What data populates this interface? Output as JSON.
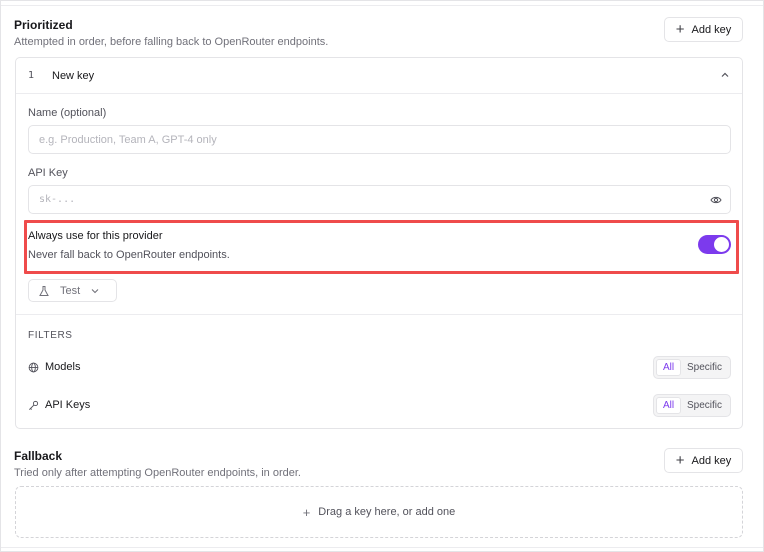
{
  "prioritized": {
    "title": "Prioritized",
    "subtitle": "Attempted in order, before falling back to OpenRouter endpoints.",
    "add_key_label": "Add key"
  },
  "key_card": {
    "number": "1",
    "title": "New key",
    "name_label": "Name (optional)",
    "name_placeholder": "e.g. Production, Team A, GPT-4 only",
    "name_value": "",
    "api_key_label": "API Key",
    "api_key_placeholder": "sk-...",
    "api_key_value": "",
    "always_title": "Always use for this provider",
    "always_subtitle": "Never fall back to OpenRouter endpoints.",
    "always_enabled": true,
    "test_label": "Test"
  },
  "filters": {
    "heading": "FILTERS",
    "rows": [
      {
        "label": "Models",
        "icon": "globe-icon",
        "options": [
          "All",
          "Specific"
        ],
        "selected": "All"
      },
      {
        "label": "API Keys",
        "icon": "key-icon",
        "options": [
          "All",
          "Specific"
        ],
        "selected": "All"
      }
    ]
  },
  "fallback": {
    "title": "Fallback",
    "subtitle": "Tried only after attempting OpenRouter endpoints, in order.",
    "add_key_label": "Add key",
    "dropzone_label": "Drag a key here, or add one"
  },
  "colors": {
    "accent": "#7c3aed",
    "highlight": "#ef4b4b"
  }
}
